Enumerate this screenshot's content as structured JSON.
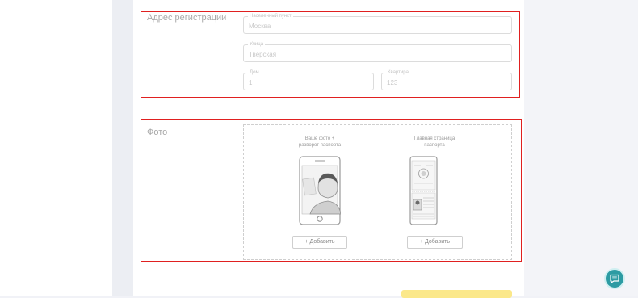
{
  "address": {
    "title": "Адрес регистрации",
    "city": {
      "label": "Населенный пункт",
      "value": "Москва"
    },
    "street": {
      "label": "Улица",
      "value": "Тверская"
    },
    "house": {
      "label": "Дом",
      "value": "1"
    },
    "apartment": {
      "label": "Квартира",
      "value": "123"
    }
  },
  "photo": {
    "title": "Фото",
    "selfie": {
      "caption_line1": "Ваше фото +",
      "caption_line2": "разворот паспорта",
      "button": "+ Добавить"
    },
    "main_pages": {
      "caption_line1": "Главная страница",
      "caption_line2": "паспорта",
      "button": "+ Добавить"
    }
  },
  "colors": {
    "highlight": "#e02020",
    "submit": "#fbe88a",
    "chat": "#2c9ba3"
  },
  "icons": {
    "chat": "chat-bubble-icon"
  }
}
